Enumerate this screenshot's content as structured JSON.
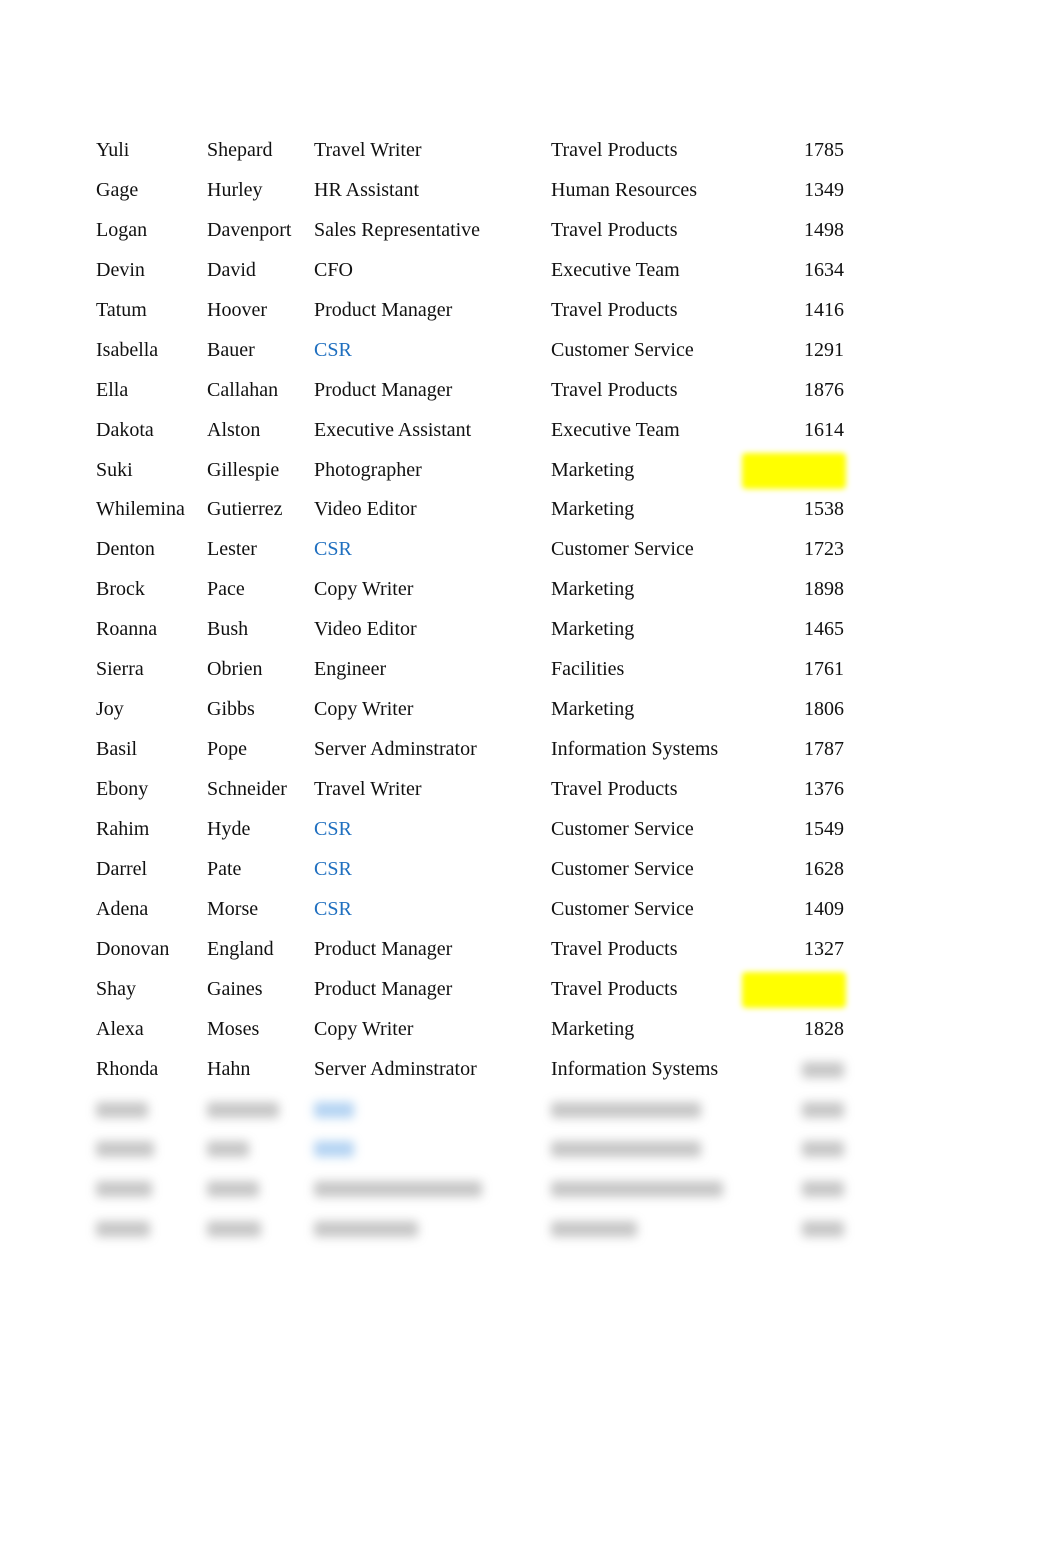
{
  "table": {
    "rows": [
      {
        "first": "Yuli",
        "last": "Shepard",
        "title": "Travel Writer",
        "department": "Travel Products",
        "value": "1785"
      },
      {
        "first": "Gage",
        "last": "Hurley",
        "title": "HR Assistant",
        "department": "Human Resources",
        "value": "1349"
      },
      {
        "first": "Logan",
        "last": "Davenport",
        "title": "Sales Representative",
        "department": "Travel Products",
        "value": "1498"
      },
      {
        "first": "Devin",
        "last": "David",
        "title": "CFO",
        "department": "Executive Team",
        "value": "1634"
      },
      {
        "first": "Tatum",
        "last": "Hoover",
        "title": "Product Manager",
        "department": "Travel Products",
        "value": "1416"
      },
      {
        "first": "Isabella",
        "last": "Bauer",
        "title": "CSR",
        "department": "Customer Service",
        "value": "1291",
        "link": true
      },
      {
        "first": "Ella",
        "last": "Callahan",
        "title": "Product Manager",
        "department": "Travel Products",
        "value": "1876"
      },
      {
        "first": "Dakota",
        "last": "Alston",
        "title": "Executive Assistant",
        "department": "Executive Team",
        "value": "1614"
      },
      {
        "first": "Suki",
        "last": "Gillespie",
        "title": "Photographer",
        "department": "Marketing",
        "value": "",
        "highlight": "#ffff00"
      },
      {
        "first": "Whilemina",
        "last": "Gutierrez",
        "title": "Video Editor",
        "department": "Marketing",
        "value": "1538"
      },
      {
        "first": "Denton",
        "last": "Lester",
        "title": "CSR",
        "department": "Customer Service",
        "value": "1723",
        "link": true
      },
      {
        "first": "Brock",
        "last": "Pace",
        "title": "Copy Writer",
        "department": "Marketing",
        "value": "1898"
      },
      {
        "first": "Roanna",
        "last": "Bush",
        "title": "Video Editor",
        "department": "Marketing",
        "value": "1465"
      },
      {
        "first": "Sierra",
        "last": "Obrien",
        "title": "Engineer",
        "department": "Facilities",
        "value": "1761"
      },
      {
        "first": "Joy",
        "last": "Gibbs",
        "title": "Copy Writer",
        "department": "Marketing",
        "value": "1806"
      },
      {
        "first": "Basil",
        "last": "Pope",
        "title": "Server Adminstrator",
        "department": "Information Systems",
        "value": "1787"
      },
      {
        "first": "Ebony",
        "last": "Schneider",
        "title": "Travel Writer",
        "department": "Travel Products",
        "value": "1376"
      },
      {
        "first": "Rahim",
        "last": "Hyde",
        "title": "CSR",
        "department": "Customer Service",
        "value": "1549",
        "link": true
      },
      {
        "first": "Darrel",
        "last": "Pate",
        "title": "CSR",
        "department": "Customer Service",
        "value": "1628",
        "link": true
      },
      {
        "first": "Adena",
        "last": "Morse",
        "title": "CSR",
        "department": "Customer Service",
        "value": "1409",
        "link": true
      },
      {
        "first": "Donovan",
        "last": "England",
        "title": "Product Manager",
        "department": "Travel Products",
        "value": "1327"
      },
      {
        "first": "Shay",
        "last": "Gaines",
        "title": "Product Manager",
        "department": "Travel Products",
        "value": "",
        "highlight": "#ffff00"
      },
      {
        "first": "Alexa",
        "last": "Moses",
        "title": "Copy Writer",
        "department": "Marketing",
        "value": "1828"
      },
      {
        "first": "Rhonda",
        "last": "Hahn",
        "title": "Server Adminstrator",
        "department": "Information Systems",
        "value": "",
        "blurred_value": true
      }
    ],
    "blurred_rows": 4,
    "link_color": "#1f6fbf"
  }
}
